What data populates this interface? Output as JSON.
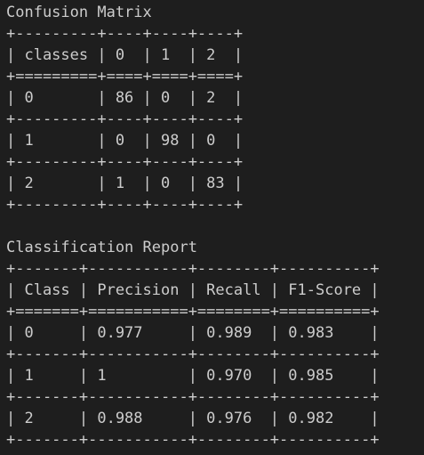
{
  "output": {
    "lines": [
      "Confusion Matrix",
      "+---------+----+----+----+",
      "| classes | 0  | 1  | 2  |",
      "+=========+====+====+====+",
      "| 0       | 86 | 0  | 2  |",
      "+---------+----+----+----+",
      "| 1       | 0  | 98 | 0  |",
      "+---------+----+----+----+",
      "| 2       | 1  | 0  | 83 |",
      "+---------+----+----+----+",
      "",
      "Classification Report",
      "+-------+-----------+--------+----------+",
      "| Class | Precision | Recall | F1-Score |",
      "+=======+===========+========+==========+",
      "| 0     | 0.977     | 0.989  | 0.983    |",
      "+-------+-----------+--------+----------+",
      "| 1     | 1         | 0.970  | 0.985    |",
      "+-------+-----------+--------+----------+",
      "| 2     | 0.988     | 0.976  | 0.982    |",
      "+-------+-----------+--------+----------+"
    ]
  }
}
